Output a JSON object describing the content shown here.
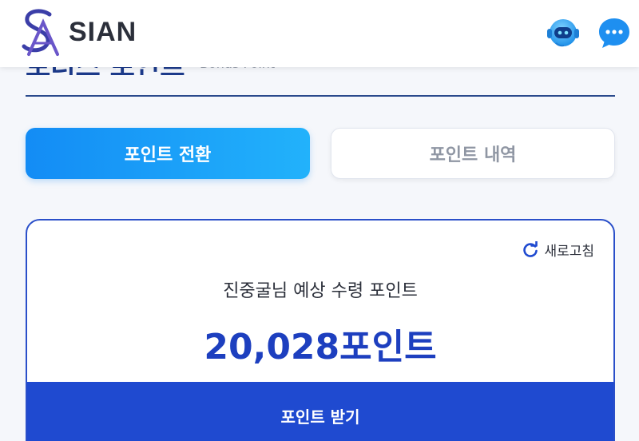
{
  "header": {
    "brand": "SIAN",
    "logo_icon": "sa-monogram-icon",
    "bot_icon": "support-bot-icon",
    "chat_icon": "chat-bubble-icon"
  },
  "page": {
    "title": "보너스 포인트",
    "subtitle": "Bonus Point"
  },
  "tabs": [
    {
      "label": "포인트 전환",
      "active": true
    },
    {
      "label": "포인트 내역",
      "active": false
    }
  ],
  "card": {
    "refresh_label": "새로고침",
    "expected_label": "진중굴님 예상 수령 포인트",
    "points_value": "20,028포인트",
    "receive_button": "포인트 받기"
  },
  "colors": {
    "primary": "#1f4ad0",
    "tab_gradient_start": "#138cf5",
    "tab_gradient_end": "#22b2fb",
    "value_text": "#1d3fbf"
  }
}
